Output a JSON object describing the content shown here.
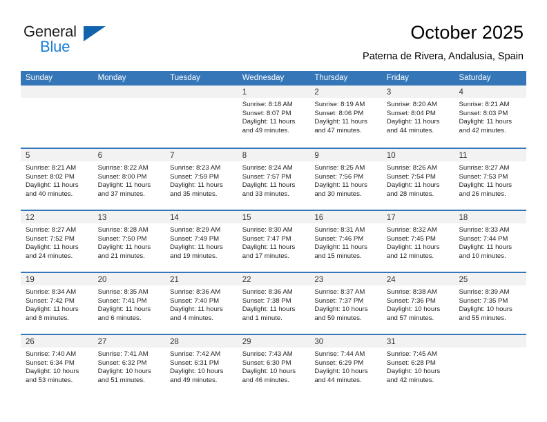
{
  "logo": {
    "word_one": "General",
    "word_two": "Blue",
    "mark": "triangle-icon",
    "colors": {
      "word_one": "#231f20",
      "word_two": "#1a7fd4",
      "mark": "#1164ac"
    }
  },
  "header": {
    "title": "October 2025",
    "subtitle": "Paterna de Rivera, Andalusia, Spain"
  },
  "theme": {
    "header_blue": "#3576b8",
    "daynum_band": "#f2f2f2",
    "text": "#222222"
  },
  "calendar": {
    "weekdays": [
      "Sunday",
      "Monday",
      "Tuesday",
      "Wednesday",
      "Thursday",
      "Friday",
      "Saturday"
    ],
    "weeks": [
      [
        {
          "day": "",
          "lines": []
        },
        {
          "day": "",
          "lines": []
        },
        {
          "day": "",
          "lines": []
        },
        {
          "day": "1",
          "lines": [
            "Sunrise: 8:18 AM",
            "Sunset: 8:07 PM",
            "Daylight: 11 hours",
            "and 49 minutes."
          ]
        },
        {
          "day": "2",
          "lines": [
            "Sunrise: 8:19 AM",
            "Sunset: 8:06 PM",
            "Daylight: 11 hours",
            "and 47 minutes."
          ]
        },
        {
          "day": "3",
          "lines": [
            "Sunrise: 8:20 AM",
            "Sunset: 8:04 PM",
            "Daylight: 11 hours",
            "and 44 minutes."
          ]
        },
        {
          "day": "4",
          "lines": [
            "Sunrise: 8:21 AM",
            "Sunset: 8:03 PM",
            "Daylight: 11 hours",
            "and 42 minutes."
          ]
        }
      ],
      [
        {
          "day": "5",
          "lines": [
            "Sunrise: 8:21 AM",
            "Sunset: 8:02 PM",
            "Daylight: 11 hours",
            "and 40 minutes."
          ]
        },
        {
          "day": "6",
          "lines": [
            "Sunrise: 8:22 AM",
            "Sunset: 8:00 PM",
            "Daylight: 11 hours",
            "and 37 minutes."
          ]
        },
        {
          "day": "7",
          "lines": [
            "Sunrise: 8:23 AM",
            "Sunset: 7:59 PM",
            "Daylight: 11 hours",
            "and 35 minutes."
          ]
        },
        {
          "day": "8",
          "lines": [
            "Sunrise: 8:24 AM",
            "Sunset: 7:57 PM",
            "Daylight: 11 hours",
            "and 33 minutes."
          ]
        },
        {
          "day": "9",
          "lines": [
            "Sunrise: 8:25 AM",
            "Sunset: 7:56 PM",
            "Daylight: 11 hours",
            "and 30 minutes."
          ]
        },
        {
          "day": "10",
          "lines": [
            "Sunrise: 8:26 AM",
            "Sunset: 7:54 PM",
            "Daylight: 11 hours",
            "and 28 minutes."
          ]
        },
        {
          "day": "11",
          "lines": [
            "Sunrise: 8:27 AM",
            "Sunset: 7:53 PM",
            "Daylight: 11 hours",
            "and 26 minutes."
          ]
        }
      ],
      [
        {
          "day": "12",
          "lines": [
            "Sunrise: 8:27 AM",
            "Sunset: 7:52 PM",
            "Daylight: 11 hours",
            "and 24 minutes."
          ]
        },
        {
          "day": "13",
          "lines": [
            "Sunrise: 8:28 AM",
            "Sunset: 7:50 PM",
            "Daylight: 11 hours",
            "and 21 minutes."
          ]
        },
        {
          "day": "14",
          "lines": [
            "Sunrise: 8:29 AM",
            "Sunset: 7:49 PM",
            "Daylight: 11 hours",
            "and 19 minutes."
          ]
        },
        {
          "day": "15",
          "lines": [
            "Sunrise: 8:30 AM",
            "Sunset: 7:47 PM",
            "Daylight: 11 hours",
            "and 17 minutes."
          ]
        },
        {
          "day": "16",
          "lines": [
            "Sunrise: 8:31 AM",
            "Sunset: 7:46 PM",
            "Daylight: 11 hours",
            "and 15 minutes."
          ]
        },
        {
          "day": "17",
          "lines": [
            "Sunrise: 8:32 AM",
            "Sunset: 7:45 PM",
            "Daylight: 11 hours",
            "and 12 minutes."
          ]
        },
        {
          "day": "18",
          "lines": [
            "Sunrise: 8:33 AM",
            "Sunset: 7:44 PM",
            "Daylight: 11 hours",
            "and 10 minutes."
          ]
        }
      ],
      [
        {
          "day": "19",
          "lines": [
            "Sunrise: 8:34 AM",
            "Sunset: 7:42 PM",
            "Daylight: 11 hours",
            "and 8 minutes."
          ]
        },
        {
          "day": "20",
          "lines": [
            "Sunrise: 8:35 AM",
            "Sunset: 7:41 PM",
            "Daylight: 11 hours",
            "and 6 minutes."
          ]
        },
        {
          "day": "21",
          "lines": [
            "Sunrise: 8:36 AM",
            "Sunset: 7:40 PM",
            "Daylight: 11 hours",
            "and 4 minutes."
          ]
        },
        {
          "day": "22",
          "lines": [
            "Sunrise: 8:36 AM",
            "Sunset: 7:38 PM",
            "Daylight: 11 hours",
            "and 1 minute."
          ]
        },
        {
          "day": "23",
          "lines": [
            "Sunrise: 8:37 AM",
            "Sunset: 7:37 PM",
            "Daylight: 10 hours",
            "and 59 minutes."
          ]
        },
        {
          "day": "24",
          "lines": [
            "Sunrise: 8:38 AM",
            "Sunset: 7:36 PM",
            "Daylight: 10 hours",
            "and 57 minutes."
          ]
        },
        {
          "day": "25",
          "lines": [
            "Sunrise: 8:39 AM",
            "Sunset: 7:35 PM",
            "Daylight: 10 hours",
            "and 55 minutes."
          ]
        }
      ],
      [
        {
          "day": "26",
          "lines": [
            "Sunrise: 7:40 AM",
            "Sunset: 6:34 PM",
            "Daylight: 10 hours",
            "and 53 minutes."
          ]
        },
        {
          "day": "27",
          "lines": [
            "Sunrise: 7:41 AM",
            "Sunset: 6:32 PM",
            "Daylight: 10 hours",
            "and 51 minutes."
          ]
        },
        {
          "day": "28",
          "lines": [
            "Sunrise: 7:42 AM",
            "Sunset: 6:31 PM",
            "Daylight: 10 hours",
            "and 49 minutes."
          ]
        },
        {
          "day": "29",
          "lines": [
            "Sunrise: 7:43 AM",
            "Sunset: 6:30 PM",
            "Daylight: 10 hours",
            "and 46 minutes."
          ]
        },
        {
          "day": "30",
          "lines": [
            "Sunrise: 7:44 AM",
            "Sunset: 6:29 PM",
            "Daylight: 10 hours",
            "and 44 minutes."
          ]
        },
        {
          "day": "31",
          "lines": [
            "Sunrise: 7:45 AM",
            "Sunset: 6:28 PM",
            "Daylight: 10 hours",
            "and 42 minutes."
          ]
        },
        {
          "day": "",
          "lines": []
        }
      ]
    ]
  }
}
